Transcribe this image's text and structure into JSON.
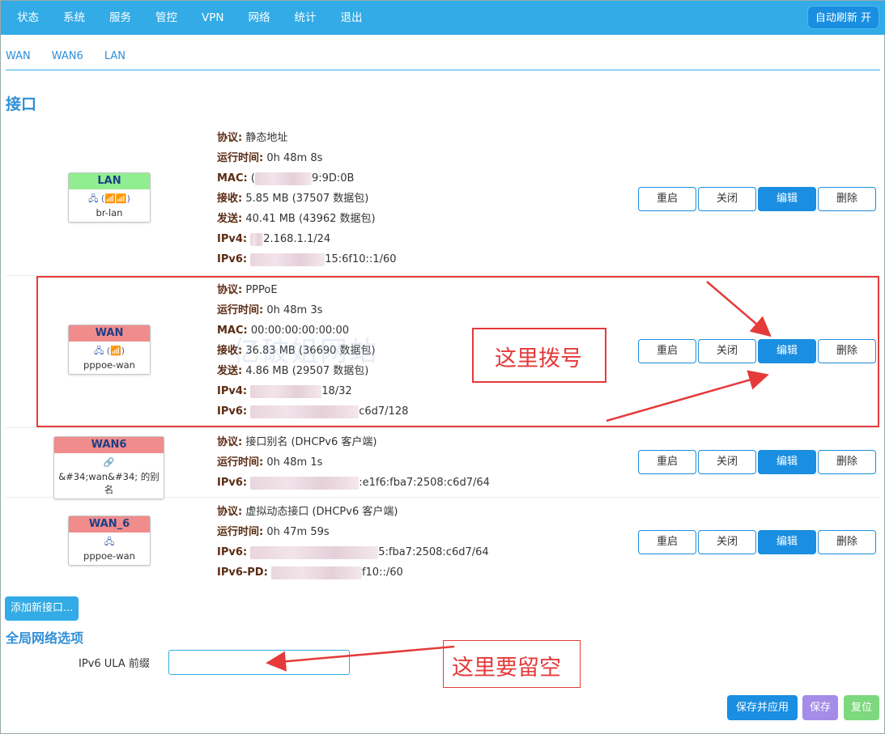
{
  "nav": {
    "items": [
      "状态",
      "系统",
      "服务",
      "管控",
      "VPN",
      "网络",
      "统计",
      "退出"
    ],
    "autorefresh": "自动刷新 开"
  },
  "subtabs": [
    "WAN",
    "WAN6",
    "LAN"
  ],
  "section_title": "接口",
  "labels": {
    "protocol": "协议:",
    "uptime": "运行时间:",
    "mac": "MAC:",
    "rx": "接收:",
    "tx": "发送:",
    "ipv4": "IPv4:",
    "ipv6": "IPv6:",
    "ipv6pd": "IPv6-PD:"
  },
  "buttons": {
    "restart": "重启",
    "stop": "关闭",
    "edit": "编辑",
    "delete": "删除"
  },
  "interfaces": [
    {
      "name": "LAN",
      "icons": "(📶📶)",
      "device": "br-lan",
      "protocol": "静态地址",
      "uptime": "0h 48m 8s",
      "mac_visible": "9:9D:0B",
      "mac_prefix": "(",
      "rx": "5.85 MB (37507 数据包)",
      "tx": "40.41 MB (43962 数据包)",
      "ipv4_visible": "2.168.1.1/24",
      "ipv6_visible": "15:6f10::1/60"
    },
    {
      "name": "WAN",
      "icons": "(📶)",
      "device": "pppoe-wan",
      "protocol": "PPPoE",
      "uptime": "0h 48m 3s",
      "mac": "00:00:00:00:00:00",
      "rx": "36.83 MB (36690 数据包)",
      "tx": "4.86 MB (29507 数据包)",
      "ipv4_visible": "18/32",
      "ipv6_visible": "c6d7/128"
    },
    {
      "name": "WAN6",
      "device": "&#34;wan&#34; 的别名",
      "protocol": "接口别名 (DHCPv6 客户端)",
      "uptime": "0h 48m 1s",
      "ipv6_visible": ":e1f6:fba7:2508:c6d7/64"
    },
    {
      "name": "WAN_6",
      "device": "pppoe-wan",
      "protocol": "虚拟动态接口 (DHCPv6 客户端)",
      "uptime": "0h 47m 59s",
      "ipv6_visible": "5:fba7:2508:c6d7/64",
      "ipv6pd_visible": "f10::/60"
    }
  ],
  "add_button": "添加新接口...",
  "global_title": "全局网络选项",
  "ula_label": "IPv6 ULA 前缀",
  "ula_value": "",
  "bottom_buttons": {
    "save_apply": "保存并应用",
    "save": "保存",
    "reset": "复位"
  },
  "annotations": {
    "dial": "这里拨号",
    "leave_empty": "这里要留空"
  },
  "watermark": "亿破姐网站",
  "colors": {
    "nav_bg": "#32abe6",
    "primary": "#1a8ee0",
    "annotation": "#e53a3a",
    "lan_green": "#90ee90",
    "wan_red": "#f08c8c",
    "save_purple": "#a48ce8",
    "reset_green": "#7ed87e"
  }
}
